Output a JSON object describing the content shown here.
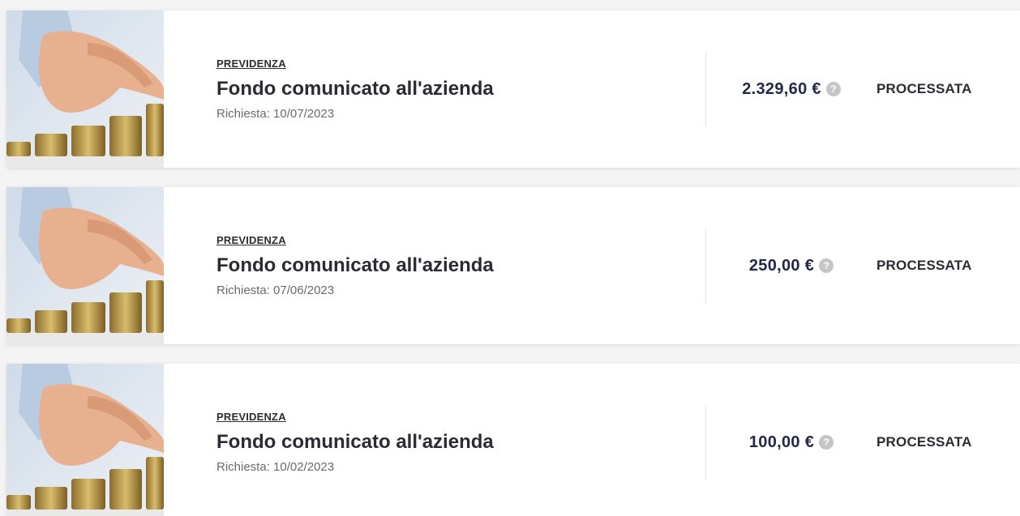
{
  "items": [
    {
      "category": "PREVIDENZA",
      "title": "Fondo comunicato all'azienda",
      "request": "Richiesta: 10/07/2023",
      "amount": "2.329,60 €",
      "help_icon": "?",
      "status": "PROCESSATA"
    },
    {
      "category": "PREVIDENZA",
      "title": "Fondo comunicato all'azienda",
      "request": "Richiesta: 07/06/2023",
      "amount": "250,00 €",
      "help_icon": "?",
      "status": "PROCESSATA"
    },
    {
      "category": "PREVIDENZA",
      "title": "Fondo comunicato all'azienda",
      "request": "Richiesta: 10/02/2023",
      "amount": "100,00 €",
      "help_icon": "?",
      "status": "PROCESSATA"
    }
  ]
}
